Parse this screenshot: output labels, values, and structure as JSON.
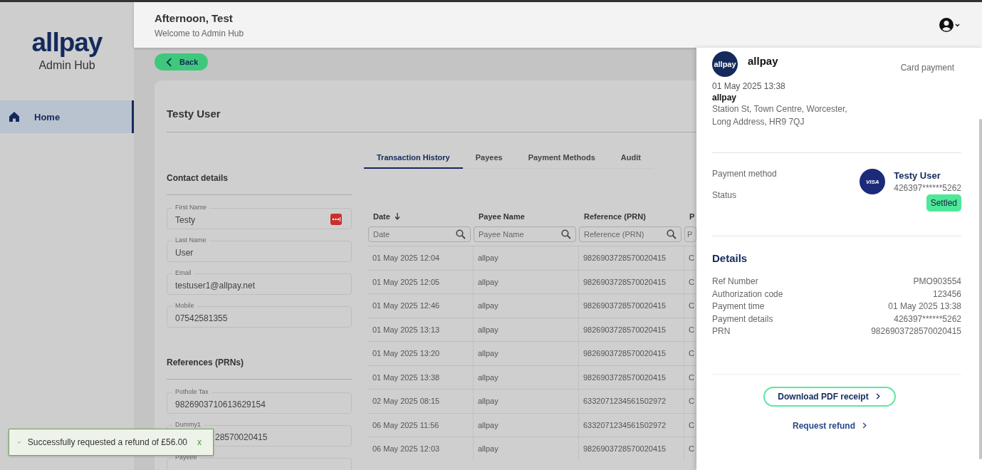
{
  "sidebar": {
    "logo": "allpay",
    "subtitle": "Admin Hub",
    "items": [
      {
        "label": "Home",
        "selected": true
      }
    ]
  },
  "header": {
    "greeting": "Afternoon, Test",
    "welcome": "Welcome to Admin Hub"
  },
  "back_button": "Back",
  "customer": {
    "name": "Testy User",
    "contact": {
      "title": "Contact details",
      "fields": [
        {
          "label": "First Name",
          "value": "Testy",
          "kind": "password-manager"
        },
        {
          "label": "Last Name",
          "value": "User",
          "kind": "plain"
        },
        {
          "label": "Email",
          "value": "testuser1@allpay.net",
          "kind": "plain"
        },
        {
          "label": "Mobile",
          "value": "07542581355",
          "kind": "plain"
        }
      ]
    },
    "references": {
      "title": "References (PRNs)",
      "fields": [
        {
          "label": "Pothole Tax",
          "value": "9826903710613629154",
          "kind": "plain"
        },
        {
          "label": "Dummy1",
          "value": "28570020415",
          "kind": "covered"
        },
        {
          "label": "Payeee",
          "kind": "cut"
        }
      ]
    }
  },
  "tabs": [
    {
      "label": "Transaction History",
      "selected": true
    },
    {
      "label": "Payees",
      "selected": false
    },
    {
      "label": "Payment Methods",
      "selected": false
    },
    {
      "label": "Audit",
      "selected": false
    }
  ],
  "table": {
    "columns": [
      {
        "label": "Date",
        "sorted": true,
        "placeholder": "Date"
      },
      {
        "label": "Payee Name",
        "sorted": false,
        "placeholder": "Payee Name"
      },
      {
        "label": "Reference (PRN)",
        "sorted": false,
        "placeholder": "Reference (PRN)"
      },
      {
        "label": "P",
        "sorted": false,
        "placeholder": "P"
      }
    ],
    "rows": [
      [
        "01 May 2025 12:04",
        "allpay",
        "9826903728570020415",
        "C"
      ],
      [
        "01 May 2025 12:05",
        "allpay",
        "9826903728570020415",
        "C"
      ],
      [
        "01 May 2025 12:46",
        "allpay",
        "9826903728570020415",
        "C"
      ],
      [
        "01 May 2025 13:13",
        "allpay",
        "9826903728570020415",
        "C"
      ],
      [
        "01 May 2025 13:20",
        "allpay",
        "9826903728570020415",
        "C"
      ],
      [
        "01 May 2025 13:38",
        "allpay",
        "9826903728570020415",
        "C"
      ],
      [
        "02 May 2025 08:15",
        "allpay",
        "6332071234561502972",
        "C"
      ],
      [
        "06 May 2025 11:56",
        "allpay",
        "6332071234561502972",
        "C"
      ],
      [
        "06 May 2025 12:03",
        "allpay",
        "9826903728570020415",
        "C"
      ]
    ]
  },
  "drawer": {
    "logo": "allpay",
    "merchant": "allpay",
    "payment_type": "Card payment",
    "date": "01 May 2025 13:38",
    "merchant_name": "allpay",
    "address": [
      "Station St, Town Centre, Worcester,",
      "Long Address, HR9 7QJ"
    ],
    "payment_method_label": "Payment method",
    "card_brand": "VISA",
    "card_holder": "Testy User",
    "card_number": "426397******5262",
    "status_label": "Status",
    "status": "Settled",
    "details_title": "Details",
    "details": [
      {
        "label": "Ref Number",
        "value": "PMO903554"
      },
      {
        "label": "Authorization code",
        "value": "123456"
      },
      {
        "label": "Payment time",
        "value": "01 May 2025 13:38"
      },
      {
        "label": "Payment details",
        "value": "426397******5262"
      },
      {
        "label": "PRN",
        "value": "9826903728570020415"
      }
    ],
    "download_button": "Download PDF receipt",
    "refund_link": "Request refund"
  },
  "toast": {
    "message": "Successfully requested a refund of £56.00",
    "close": "x"
  }
}
